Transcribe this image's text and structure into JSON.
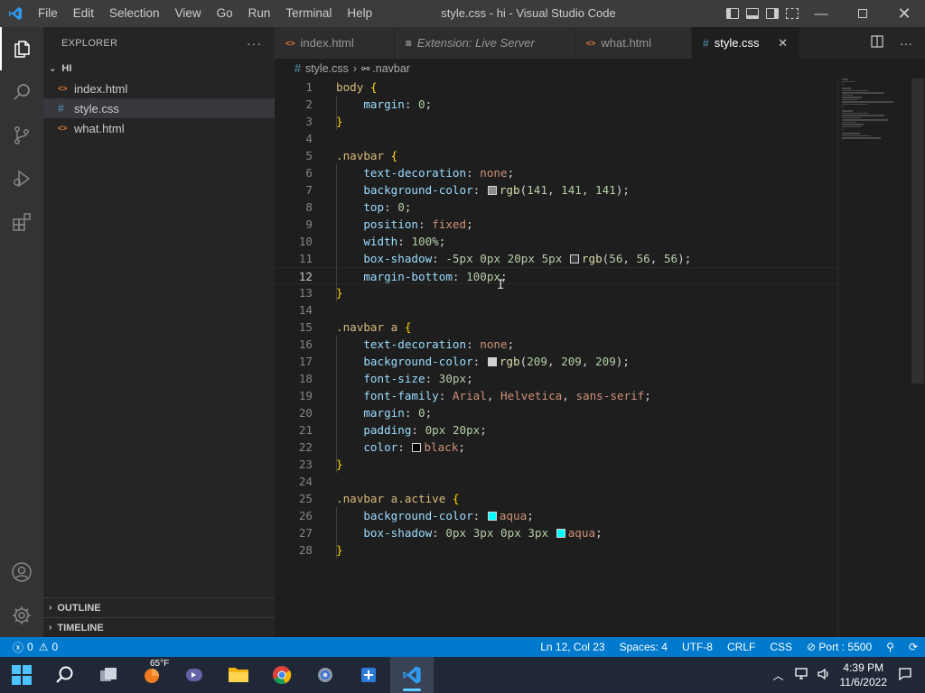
{
  "window": {
    "title": "style.css - hi - Visual Studio Code",
    "menu": [
      "File",
      "Edit",
      "Selection",
      "View",
      "Go",
      "Run",
      "Terminal",
      "Help"
    ]
  },
  "sidebar": {
    "header": "EXPLORER",
    "more": "···",
    "folder": "HI",
    "files": [
      {
        "name": "index.html",
        "icon": "html-file-icon",
        "selected": false
      },
      {
        "name": "style.css",
        "icon": "css-file-icon",
        "selected": true
      },
      {
        "name": "what.html",
        "icon": "html-file-icon",
        "selected": false
      }
    ],
    "outline": "OUTLINE",
    "timeline": "TIMELINE"
  },
  "tabs": [
    {
      "label": "index.html",
      "icon": "html-file-icon",
      "italic": false,
      "active": false
    },
    {
      "label": "Extension: Live Server",
      "icon": "extension-preview-icon",
      "italic": true,
      "active": false
    },
    {
      "label": "what.html",
      "icon": "html-file-icon",
      "italic": false,
      "active": false
    },
    {
      "label": "style.css",
      "icon": "css-file-icon",
      "italic": false,
      "active": true
    }
  ],
  "breadcrumb": {
    "file": "style.css",
    "symbol": ".navbar"
  },
  "editor": {
    "current_line": 12,
    "lines": [
      {
        "n": "1",
        "t": [
          [
            "sel",
            "body"
          ],
          [
            "pl",
            " "
          ],
          [
            "br",
            "{"
          ]
        ]
      },
      {
        "n": "2",
        "t": [
          [
            "pl",
            "    "
          ],
          [
            "prop",
            "margin"
          ],
          [
            "pl",
            ": "
          ],
          [
            "num",
            "0"
          ],
          [
            "pl",
            ";"
          ]
        ]
      },
      {
        "n": "3",
        "t": [
          [
            "br",
            "}"
          ]
        ]
      },
      {
        "n": "4",
        "t": []
      },
      {
        "n": "5",
        "t": [
          [
            "sel",
            ".navbar"
          ],
          [
            "pl",
            " "
          ],
          [
            "br",
            "{"
          ]
        ]
      },
      {
        "n": "6",
        "t": [
          [
            "pl",
            "    "
          ],
          [
            "prop",
            "text-decoration"
          ],
          [
            "pl",
            ": "
          ],
          [
            "val",
            "none"
          ],
          [
            "pl",
            ";"
          ]
        ]
      },
      {
        "n": "7",
        "t": [
          [
            "pl",
            "    "
          ],
          [
            "prop",
            "background-color"
          ],
          [
            "pl",
            ": "
          ],
          [
            "swatch",
            "#8d8d8d"
          ],
          [
            "fn",
            "rgb"
          ],
          [
            "pl",
            "("
          ],
          [
            "num",
            "141"
          ],
          [
            "pl",
            ", "
          ],
          [
            "num",
            "141"
          ],
          [
            "pl",
            ", "
          ],
          [
            "num",
            "141"
          ],
          [
            "pl",
            ");"
          ]
        ]
      },
      {
        "n": "8",
        "t": [
          [
            "pl",
            "    "
          ],
          [
            "prop",
            "top"
          ],
          [
            "pl",
            ": "
          ],
          [
            "num",
            "0"
          ],
          [
            "pl",
            ";"
          ]
        ]
      },
      {
        "n": "9",
        "t": [
          [
            "pl",
            "    "
          ],
          [
            "prop",
            "position"
          ],
          [
            "pl",
            ": "
          ],
          [
            "val",
            "fixed"
          ],
          [
            "pl",
            ";"
          ]
        ]
      },
      {
        "n": "10",
        "t": [
          [
            "pl",
            "    "
          ],
          [
            "prop",
            "width"
          ],
          [
            "pl",
            ": "
          ],
          [
            "num",
            "100%"
          ],
          [
            "pl",
            ";"
          ]
        ]
      },
      {
        "n": "11",
        "t": [
          [
            "pl",
            "    "
          ],
          [
            "prop",
            "box-shadow"
          ],
          [
            "pl",
            ": "
          ],
          [
            "num",
            "-5px"
          ],
          [
            "pl",
            " "
          ],
          [
            "num",
            "0px"
          ],
          [
            "pl",
            " "
          ],
          [
            "num",
            "20px"
          ],
          [
            "pl",
            " "
          ],
          [
            "num",
            "5px"
          ],
          [
            "pl",
            " "
          ],
          [
            "swatch",
            "#383838"
          ],
          [
            "fn",
            "rgb"
          ],
          [
            "pl",
            "("
          ],
          [
            "num",
            "56"
          ],
          [
            "pl",
            ", "
          ],
          [
            "num",
            "56"
          ],
          [
            "pl",
            ", "
          ],
          [
            "num",
            "56"
          ],
          [
            "pl",
            ");"
          ]
        ]
      },
      {
        "n": "12",
        "t": [
          [
            "pl",
            "    "
          ],
          [
            "prop",
            "margin-bottom"
          ],
          [
            "pl",
            ": "
          ],
          [
            "num",
            "100px"
          ],
          [
            "pl",
            ";"
          ]
        ]
      },
      {
        "n": "13",
        "t": [
          [
            "br",
            "}"
          ]
        ]
      },
      {
        "n": "14",
        "t": []
      },
      {
        "n": "15",
        "t": [
          [
            "sel",
            ".navbar a"
          ],
          [
            "pl",
            " "
          ],
          [
            "br",
            "{"
          ]
        ]
      },
      {
        "n": "16",
        "t": [
          [
            "pl",
            "    "
          ],
          [
            "prop",
            "text-decoration"
          ],
          [
            "pl",
            ": "
          ],
          [
            "val",
            "none"
          ],
          [
            "pl",
            ";"
          ]
        ]
      },
      {
        "n": "17",
        "t": [
          [
            "pl",
            "    "
          ],
          [
            "prop",
            "background-color"
          ],
          [
            "pl",
            ": "
          ],
          [
            "swatch",
            "#d1d1d1"
          ],
          [
            "fn",
            "rgb"
          ],
          [
            "pl",
            "("
          ],
          [
            "num",
            "209"
          ],
          [
            "pl",
            ", "
          ],
          [
            "num",
            "209"
          ],
          [
            "pl",
            ", "
          ],
          [
            "num",
            "209"
          ],
          [
            "pl",
            ");"
          ]
        ]
      },
      {
        "n": "18",
        "t": [
          [
            "pl",
            "    "
          ],
          [
            "prop",
            "font-size"
          ],
          [
            "pl",
            ": "
          ],
          [
            "num",
            "30px"
          ],
          [
            "pl",
            ";"
          ]
        ]
      },
      {
        "n": "19",
        "t": [
          [
            "pl",
            "    "
          ],
          [
            "prop",
            "font-family"
          ],
          [
            "pl",
            ": "
          ],
          [
            "val",
            "Arial"
          ],
          [
            "pl",
            ", "
          ],
          [
            "val",
            "Helvetica"
          ],
          [
            "pl",
            ", "
          ],
          [
            "val",
            "sans-serif"
          ],
          [
            "pl",
            ";"
          ]
        ]
      },
      {
        "n": "20",
        "t": [
          [
            "pl",
            "    "
          ],
          [
            "prop",
            "margin"
          ],
          [
            "pl",
            ": "
          ],
          [
            "num",
            "0"
          ],
          [
            "pl",
            ";"
          ]
        ]
      },
      {
        "n": "21",
        "t": [
          [
            "pl",
            "    "
          ],
          [
            "prop",
            "padding"
          ],
          [
            "pl",
            ": "
          ],
          [
            "num",
            "0px"
          ],
          [
            "pl",
            " "
          ],
          [
            "num",
            "20px"
          ],
          [
            "pl",
            ";"
          ]
        ]
      },
      {
        "n": "22",
        "t": [
          [
            "pl",
            "    "
          ],
          [
            "prop",
            "color"
          ],
          [
            "pl",
            ": "
          ],
          [
            "swatch",
            "#000000"
          ],
          [
            "val",
            "black"
          ],
          [
            "pl",
            ";"
          ]
        ]
      },
      {
        "n": "23",
        "t": [
          [
            "br",
            "}"
          ]
        ]
      },
      {
        "n": "24",
        "t": []
      },
      {
        "n": "25",
        "t": [
          [
            "sel",
            ".navbar a.active"
          ],
          [
            "pl",
            " "
          ],
          [
            "br",
            "{"
          ]
        ]
      },
      {
        "n": "26",
        "t": [
          [
            "pl",
            "    "
          ],
          [
            "prop",
            "background-color"
          ],
          [
            "pl",
            ": "
          ],
          [
            "swatch",
            "#00ffff"
          ],
          [
            "val",
            "aqua"
          ],
          [
            "pl",
            ";"
          ]
        ]
      },
      {
        "n": "27",
        "t": [
          [
            "pl",
            "    "
          ],
          [
            "prop",
            "box-shadow"
          ],
          [
            "pl",
            ": "
          ],
          [
            "num",
            "0px"
          ],
          [
            "pl",
            " "
          ],
          [
            "num",
            "3px"
          ],
          [
            "pl",
            " "
          ],
          [
            "num",
            "0px"
          ],
          [
            "pl",
            " "
          ],
          [
            "num",
            "3px"
          ],
          [
            "pl",
            " "
          ],
          [
            "swatch",
            "#00ffff"
          ],
          [
            "val",
            "aqua"
          ],
          [
            "pl",
            ";"
          ]
        ]
      },
      {
        "n": "28",
        "t": [
          [
            "br",
            "}"
          ]
        ]
      }
    ]
  },
  "statusbar": {
    "errors": "0",
    "warnings": "0",
    "position": "Ln 12, Col 23",
    "spaces": "Spaces: 4",
    "encoding": "UTF-8",
    "eol": "CRLF",
    "language": "CSS",
    "port": "Port : 5500"
  },
  "taskbar": {
    "weather": "65°F",
    "time": "4:39 PM",
    "date": "11/6/2022"
  },
  "colors": {
    "accent": "#007acc",
    "titlebar": "#3c3c3c",
    "activitybar": "#333333",
    "sidebar": "#252526",
    "editor": "#1e1e1e"
  }
}
